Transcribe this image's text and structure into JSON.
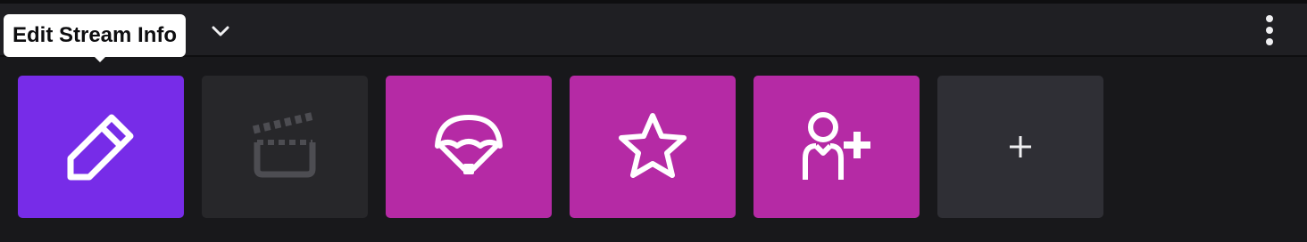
{
  "tooltip": {
    "text": "Edit Stream Info"
  },
  "header": {
    "collapse_icon": "chevron-down-icon",
    "more_icon": "more-vertical-icon"
  },
  "tiles": [
    {
      "icon": "pencil-icon",
      "color": "#772ce8",
      "state": "active"
    },
    {
      "icon": "clapperboard-icon",
      "color": "#27272a",
      "state": "disabled"
    },
    {
      "icon": "parachute-icon",
      "color": "#b52aa5",
      "state": "enabled"
    },
    {
      "icon": "star-icon",
      "color": "#b52aa5",
      "state": "enabled"
    },
    {
      "icon": "add-user-icon",
      "color": "#b52aa5",
      "state": "enabled"
    },
    {
      "icon": "plus-icon",
      "color": "#2f2f35",
      "state": "enabled"
    }
  ],
  "colors": {
    "background": "#18181b",
    "header": "#1f1f23",
    "accent_purple": "#772ce8",
    "accent_magenta": "#b52aa5"
  }
}
